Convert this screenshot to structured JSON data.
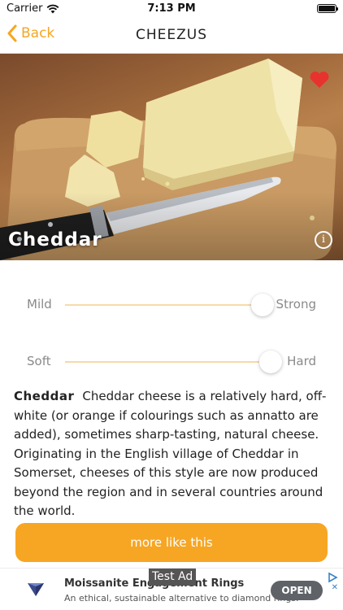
{
  "status_bar": {
    "carrier": "Carrier",
    "time": "7:13 PM"
  },
  "nav": {
    "back_label": "Back",
    "title": "CHEEZUS"
  },
  "hero": {
    "cheese_name": "Cheddar",
    "info_glyph": "i",
    "favorite": true,
    "accent_heart_color": "#e8322e"
  },
  "sliders": [
    {
      "left_label": "Mild",
      "right_label": "Strong",
      "value": 0.96
    },
    {
      "left_label": "Soft",
      "right_label": "Hard",
      "value": 1.0
    }
  ],
  "description": {
    "name": "Cheddar",
    "text": "Cheddar cheese is a relatively hard, off-white (or orange if colourings such as annatto are added), sometimes sharp-tasting, natural cheese. Originating in the English village of Cheddar in Somerset, cheeses of this style are now produced beyond the region and in several countries around the world."
  },
  "more_button": {
    "label": "more like this",
    "color": "#f6a623"
  },
  "ad": {
    "label": "Test Ad",
    "title": "Moissanite Engagement Rings",
    "body": "An ethical, sustainable alternative to diamond rings.",
    "cta": "OPEN"
  },
  "colors": {
    "accent": "#f6a623",
    "slider_track": "#f7d9a8"
  }
}
